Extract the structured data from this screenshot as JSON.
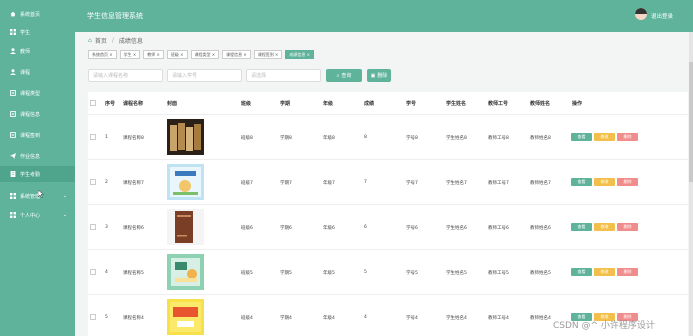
{
  "header": {
    "app_title": "学生信息管理系统",
    "logout_label": "退出登录"
  },
  "sidebar": {
    "items": [
      {
        "label": "系统首页",
        "icon": "home-icon"
      },
      {
        "label": "学生",
        "icon": "grid-icon"
      },
      {
        "label": "教师",
        "icon": "user-icon"
      },
      {
        "label": "课程",
        "icon": "user-icon"
      },
      {
        "label": "课程类型",
        "icon": "book-icon"
      },
      {
        "label": "课程信息",
        "icon": "book-icon"
      },
      {
        "label": "课程签到",
        "icon": "book-icon"
      },
      {
        "label": "作业信息",
        "icon": "send-icon"
      },
      {
        "label": "学生考勤",
        "icon": "doc-icon"
      },
      {
        "label": "系统管理",
        "icon": "grid-icon"
      },
      {
        "label": "个人中心",
        "icon": "grid-icon"
      }
    ]
  },
  "breadcrumb": {
    "home": "首页",
    "separator": "/",
    "current": "成绩信息"
  },
  "tags": [
    "系统首页 ×",
    "学生 ×",
    "教师 ×",
    "班级 ×",
    "课程类型 ×",
    "课程信息 ×",
    "课程签到 ×",
    "成绩信息 ×"
  ],
  "search": {
    "course_placeholder": "请输入课程名称",
    "student_placeholder": "请输入学号",
    "grade_placeholder": "请选择",
    "search_label": "查询",
    "delete_label": "删除"
  },
  "table": {
    "headers": [
      "序号",
      "课程名称",
      "封面",
      "班级",
      "学期",
      "年级",
      "成绩",
      "学号",
      "学生姓名",
      "教师工号",
      "教师姓名",
      "操作"
    ],
    "actions": {
      "view": "查看",
      "edit": "修改",
      "delete": "删除"
    },
    "rows": [
      {
        "no": "1",
        "course": "课程名称8",
        "class": "班级8",
        "term": "学期8",
        "grade": "年级8",
        "score": "8",
        "student_no": "学号8",
        "student_name": "学生姓名8",
        "teacher_no": "教师工号8",
        "teacher_name": "教师姓名8"
      },
      {
        "no": "2",
        "course": "课程名称7",
        "class": "班级7",
        "term": "学期7",
        "grade": "年级7",
        "score": "7",
        "student_no": "学号7",
        "student_name": "学生姓名7",
        "teacher_no": "教师工号7",
        "teacher_name": "教师姓名7"
      },
      {
        "no": "3",
        "course": "课程名称6",
        "class": "班级6",
        "term": "学期6",
        "grade": "年级6",
        "score": "6",
        "student_no": "学号6",
        "student_name": "学生姓名6",
        "teacher_no": "教师工号6",
        "teacher_name": "教师姓名6"
      },
      {
        "no": "4",
        "course": "课程名称5",
        "class": "班级5",
        "term": "学期5",
        "grade": "年级5",
        "score": "5",
        "student_no": "学号5",
        "student_name": "学生姓名5",
        "teacher_no": "教师工号5",
        "teacher_name": "教师姓名5"
      },
      {
        "no": "5",
        "course": "课程名称4",
        "class": "班级4",
        "term": "学期4",
        "grade": "年级4",
        "score": "4",
        "student_no": "学号4",
        "student_name": "学生姓名4",
        "teacher_no": "教师工号4",
        "teacher_name": "教师姓名4"
      }
    ]
  },
  "watermark": "CSDN @^ 小许程序设计",
  "colors": {
    "primary": "#5fb39b",
    "edit": "#f2c04a",
    "delete": "#f08c8c"
  }
}
